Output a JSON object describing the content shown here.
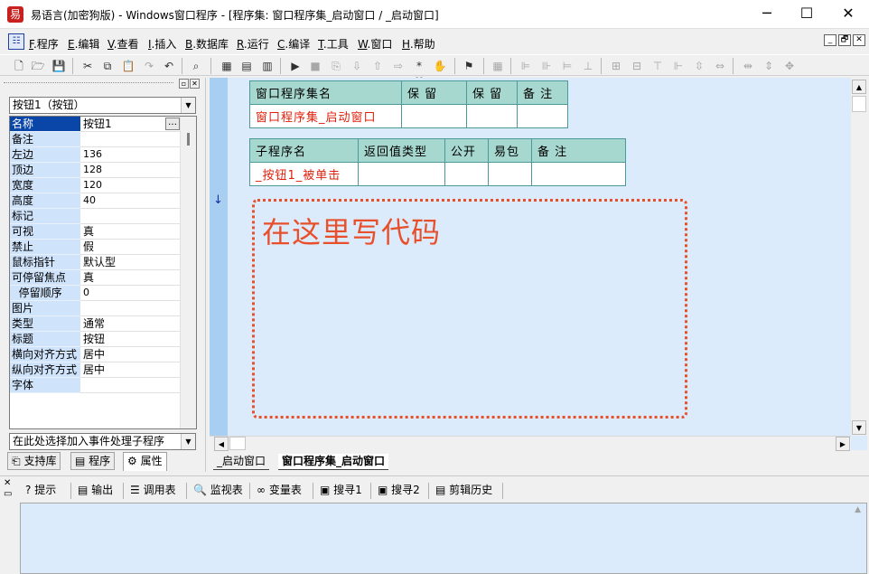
{
  "window": {
    "title": "易语言(加密狗版) - Windows窗口程序 - [程序集: 窗口程序集_启动窗口 / _启动窗口]",
    "app_icon": "易",
    "minimize": "─",
    "maximize": "☐",
    "close": "✕"
  },
  "menu": {
    "items": [
      {
        "key": "F",
        "label": ".程序"
      },
      {
        "key": "E",
        "label": ".编辑"
      },
      {
        "key": "V",
        "label": ".查看"
      },
      {
        "key": "I",
        "label": ".插入"
      },
      {
        "key": "B",
        "label": ".数据库"
      },
      {
        "key": "R",
        "label": ".运行"
      },
      {
        "key": "C",
        "label": ".编译"
      },
      {
        "key": "T",
        "label": ".工具"
      },
      {
        "key": "W",
        "label": ".窗口"
      },
      {
        "key": "H",
        "label": ".帮助"
      }
    ],
    "mdi": [
      "_",
      "🗗",
      "✕"
    ]
  },
  "toolbar": {
    "icons": [
      "new-file-icon",
      "open-folder-icon",
      "save-icon",
      "cut-icon",
      "copy-icon",
      "paste-icon",
      "redo-icon",
      "undo-icon",
      "find-icon",
      "layout1-icon",
      "layout2-icon",
      "layout3-icon",
      "run-icon",
      "stop-icon",
      "step-icon",
      "step-into-icon",
      "step-out-icon",
      "step-over-icon",
      "breakpoint-icon",
      "hand-icon",
      "debug-person-icon",
      "grid-icon",
      "align-left-icon",
      "align-center-icon",
      "align-right-icon",
      "align-top-icon",
      "space-h-icon",
      "space-v-icon",
      "center-h-icon",
      "width-icon",
      "height-icon",
      "size-icon",
      "equal-w-icon",
      "equal-h-icon",
      "equal-size-icon"
    ]
  },
  "left": {
    "component_combo": "按钮1（按钮）",
    "props": [
      {
        "name": "名称",
        "value": "按钮1",
        "selected": true
      },
      {
        "name": "备注",
        "value": ""
      },
      {
        "name": "左边",
        "value": "136"
      },
      {
        "name": "顶边",
        "value": "128"
      },
      {
        "name": "宽度",
        "value": "120"
      },
      {
        "name": "高度",
        "value": "40"
      },
      {
        "name": "标记",
        "value": ""
      },
      {
        "name": "可视",
        "value": "真"
      },
      {
        "name": "禁止",
        "value": "假"
      },
      {
        "name": "鼠标指针",
        "value": "默认型"
      },
      {
        "name": "可停留焦点",
        "value": "真"
      },
      {
        "name": "  停留顺序",
        "value": "0"
      },
      {
        "name": "图片",
        "value": ""
      },
      {
        "name": "类型",
        "value": "通常"
      },
      {
        "name": "标题",
        "value": "按钮"
      },
      {
        "name": "横向对齐方式",
        "value": "居中"
      },
      {
        "name": "纵向对齐方式",
        "value": "居中"
      },
      {
        "name": "字体",
        "value": ""
      }
    ],
    "event_combo": "在此处选择加入事件处理子程序",
    "tabs": [
      "支持库",
      "程序",
      "属性"
    ],
    "ellipsis": "…"
  },
  "editor": {
    "assembly": {
      "headers": [
        "窗口程序集名",
        "保 留",
        "保 留",
        "备 注"
      ],
      "row": [
        "窗口程序集_启动窗口",
        "",
        "",
        ""
      ]
    },
    "sub": {
      "headers": [
        "子程序名",
        "返回值类型",
        "公开",
        "易包",
        "备 注"
      ],
      "row": [
        "_按钮1_被单击",
        "",
        "",
        "",
        ""
      ]
    },
    "code_hint": "在这里写代码",
    "gutter_arrow": "↓",
    "tabs": [
      "_启动窗口",
      "窗口程序集_启动窗口"
    ]
  },
  "output": {
    "tabs": [
      {
        "icon": "hint-icon",
        "glyph": "?",
        "label": "提示"
      },
      {
        "icon": "output-icon",
        "glyph": "▤",
        "label": "输出"
      },
      {
        "icon": "call-stack-icon",
        "glyph": "☰",
        "label": "调用表"
      },
      {
        "icon": "watch-icon",
        "glyph": "🔍",
        "label": "监视表"
      },
      {
        "icon": "variables-icon",
        "glyph": "∞",
        "label": "变量表"
      },
      {
        "icon": "search1-icon",
        "glyph": "▣",
        "label": "搜寻1"
      },
      {
        "icon": "search2-icon",
        "glyph": "▣",
        "label": "搜寻2"
      },
      {
        "icon": "clipboard-icon",
        "glyph": "▤",
        "label": "剪辑历史"
      }
    ]
  }
}
